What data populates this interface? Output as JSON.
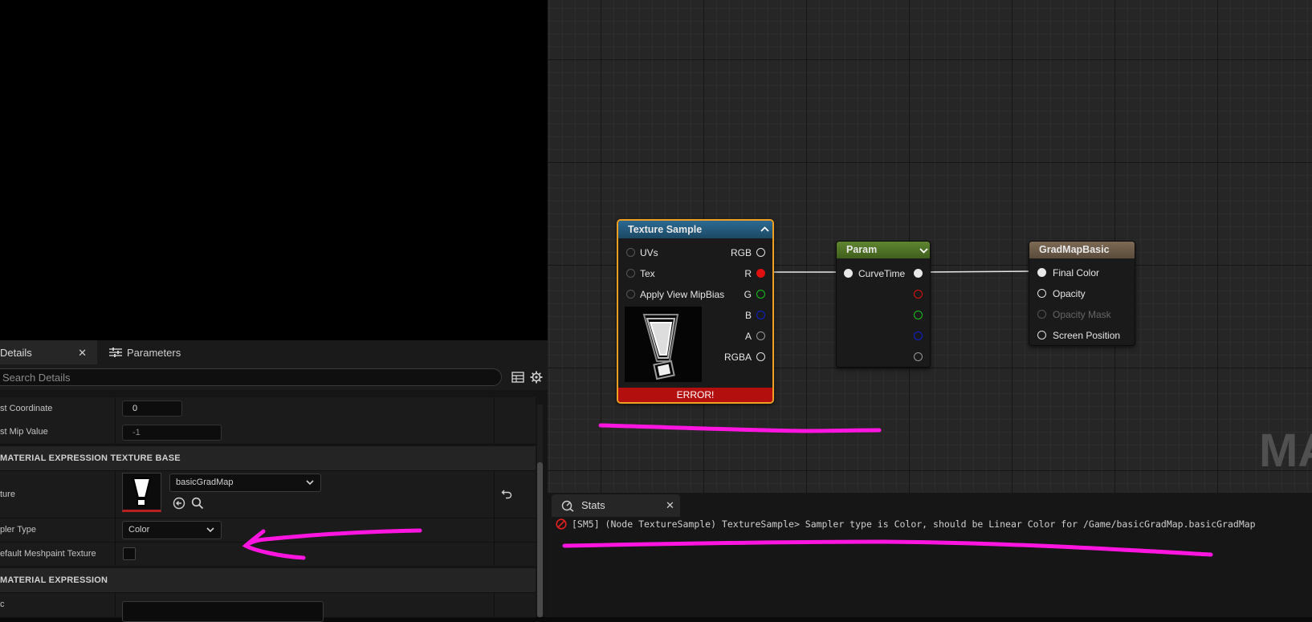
{
  "details_panel": {
    "tab_details": "Details",
    "tab_parameters": "Parameters",
    "search_placeholder": "Search Details",
    "rows": {
      "const_coordinate": {
        "label": "st Coordinate",
        "value": "0"
      },
      "const_mip": {
        "label": "st Mip Value",
        "value": "-1"
      }
    },
    "cat_texture_base": "MATERIAL EXPRESSION TEXTURE BASE",
    "texture_row": {
      "label": "ture",
      "value": "basicGradMap"
    },
    "sampler_row": {
      "label": "pler Type",
      "value": "Color"
    },
    "meshpaint_row": {
      "label": "efault Meshpaint Texture"
    },
    "cat_expression": "MATERIAL EXPRESSION",
    "desc_row": {
      "label": "c"
    }
  },
  "graph": {
    "texture_sample": {
      "title": "Texture Sample",
      "inputs": [
        "UVs",
        "Tex",
        "Apply View MipBias"
      ],
      "outputs": [
        "RGB",
        "R",
        "G",
        "B",
        "A",
        "RGBA"
      ],
      "error": "ERROR!"
    },
    "param": {
      "title": "Param",
      "input": "CurveTime"
    },
    "gradmap": {
      "title": "GradMapBasic",
      "inputs": [
        "Final Color",
        "Opacity",
        "Opacity Mask",
        "Screen Position"
      ]
    },
    "watermark": "MA"
  },
  "stats": {
    "tab_label": "Stats",
    "message": "[SM5] (Node TextureSample) TextureSample> Sampler type is Color, should be Linear Color for /Game/basicGradMap.basicGradMap"
  },
  "colors": {
    "annotation": "#ff14e0",
    "error": "#b40f0f",
    "selection": "#f0a020",
    "pin_r": "#e01010",
    "pin_g": "#18c018",
    "pin_b": "#1020d0"
  }
}
